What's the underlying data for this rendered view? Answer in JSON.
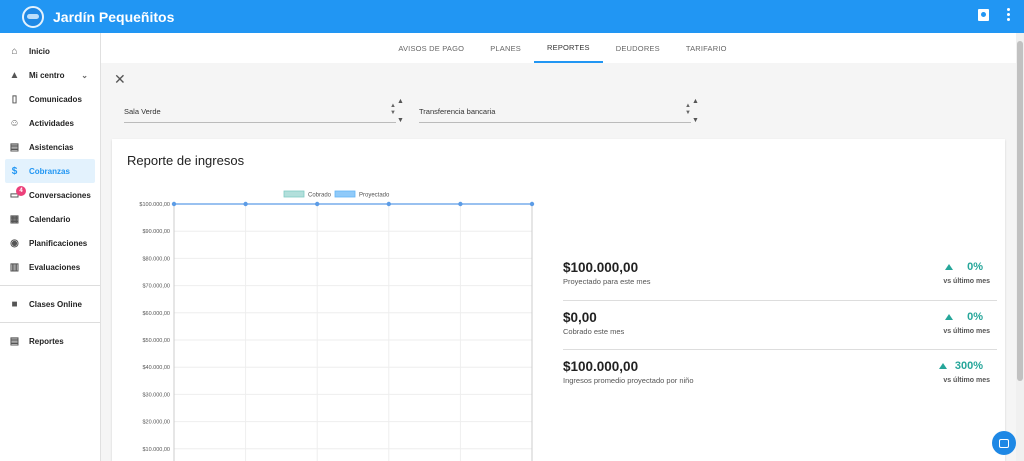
{
  "app": {
    "title": "Jardín Pequeñitos"
  },
  "sidebar": {
    "items": [
      {
        "label": "Inicio",
        "icon": "home-icon"
      },
      {
        "label": "Mi centro",
        "icon": "school-icon"
      },
      {
        "label": "Comunicados",
        "icon": "phone-icon"
      },
      {
        "label": "Actividades",
        "icon": "face-icon"
      },
      {
        "label": "Asistencias",
        "icon": "clipboard-icon"
      },
      {
        "label": "Cobranzas",
        "icon": "dollar-icon"
      },
      {
        "label": "Conversaciones",
        "icon": "chat-icon",
        "badge": "4"
      },
      {
        "label": "Calendario",
        "icon": "calendar-icon"
      },
      {
        "label": "Planificaciones",
        "icon": "compass-icon"
      },
      {
        "label": "Evaluaciones",
        "icon": "bar-chart-icon"
      },
      {
        "label": "Clases Online",
        "icon": "video-icon"
      },
      {
        "label": "Reportes",
        "icon": "document-icon"
      }
    ]
  },
  "tabs": [
    "AVISOS DE PAGO",
    "PLANES",
    "REPORTES",
    "DEUDORES",
    "TARIFARIO"
  ],
  "filters": {
    "room": "Sala Verde",
    "method": "Transferencia bancaria"
  },
  "report": {
    "title": "Reporte de ingresos",
    "stats": [
      {
        "value": "$100.000,00",
        "label": "Proyectado para este mes",
        "pct": "0%",
        "vs": "vs último mes"
      },
      {
        "value": "$0,00",
        "label": "Cobrado este mes",
        "pct": "0%",
        "vs": "vs último mes"
      },
      {
        "value": "$100.000,00",
        "label": "Ingresos promedio proyectado por niño",
        "pct": "300%",
        "vs": "vs último mes"
      }
    ]
  },
  "chart_data": {
    "type": "line",
    "series": [
      {
        "name": "Cobrado",
        "values": []
      },
      {
        "name": "Proyectado",
        "values": [
          100000,
          100000,
          100000,
          100000,
          100000,
          100000
        ]
      }
    ],
    "yticks": [
      "$100.000,00",
      "$90.000,00",
      "$80.000,00",
      "$70.000,00",
      "$60.000,00",
      "$50.000,00",
      "$40.000,00",
      "$30.000,00",
      "$20.000,00",
      "$10.000,00"
    ],
    "ylim": [
      0,
      100000
    ],
    "colors": {
      "cobrado": "#b2dfdb",
      "proyectado": "#90caf9",
      "line": "#5c9ce6"
    }
  }
}
